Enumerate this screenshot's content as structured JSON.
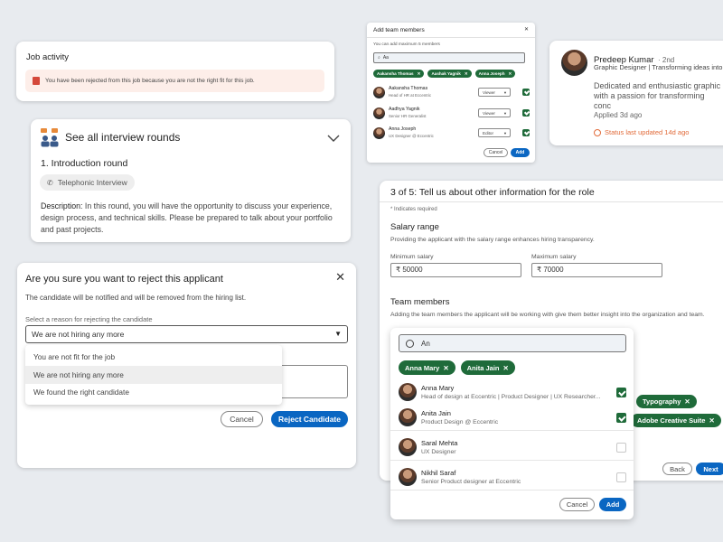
{
  "job_activity": {
    "title": "Job activity",
    "alert_text": "You have been rejected from this job because you are not the right fit for this job."
  },
  "interview": {
    "title": "See all interview rounds",
    "round_title": "1. Introduction round",
    "chip_label": "Telephonic Interview",
    "desc_label": "Description:",
    "desc_text": "In this round, you will have the opportunity to discuss your experience, design process, and technical skills. Please be prepared to talk about your portfolio and past projects."
  },
  "reject": {
    "title": "Are you sure you want to reject this applicant",
    "subtitle": "The candidate will be notified and will be removed from the hiring list.",
    "reason_label": "Select a reason for rejecting the candidate",
    "selected_value": "We are not hiring any more",
    "options": [
      "You are not fit for the job",
      "We are not hiring any more",
      "We found the right candidate"
    ],
    "cancel_label": "Cancel",
    "confirm_label": "Reject Candidate"
  },
  "add_team": {
    "title": "Add team members",
    "hint": "You can add maximum 5 members",
    "search_value": "Aa",
    "pills": [
      "Aakansha Thomas",
      "Aashak Yagnik",
      "Anna Joseph"
    ],
    "members": [
      {
        "name": "Aakansha Thomas",
        "role": "Head of HR at Eccentric",
        "permission": "Viewer",
        "checked": true
      },
      {
        "name": "Aadhya Yagnik",
        "role": "Senior HR Generalist",
        "permission": "Viewer",
        "checked": true
      },
      {
        "name": "Anna Joseph",
        "role": "UX Designer @ Eccentric",
        "permission": "Editor",
        "checked": true
      }
    ],
    "cancel_label": "Cancel",
    "add_label": "Add"
  },
  "profile": {
    "name": "Predeep Kumar",
    "degree": "· 2nd",
    "headline": "Graphic Designer | Transforming ideas into",
    "bio": "Dedicated and enthusiastic graphic with a passion for transforming conc",
    "applied": "Applied 3d ago",
    "status": "Status last updated 14d ago"
  },
  "role_form": {
    "title": "3 of 5: Tell us about other information for the role",
    "required_note": "* Indicates required",
    "salary_heading": "Salary range",
    "salary_desc": "Providing the applicant with the salary range enhances hiring transparency.",
    "min_label": "Minimum salary",
    "min_value": "50000",
    "max_label": "Maximum salary",
    "max_value": "70000",
    "currency": "₹",
    "team_heading": "Team members",
    "team_desc": "Adding the team members the applicant will be working with give them better insight into the organization and team.",
    "skill_pills": [
      "Typography",
      "Adobe Creative Suite"
    ],
    "back_label": "Back",
    "next_label": "Next"
  },
  "team_dropdown": {
    "search_value": "An",
    "pills": [
      "Anna Mary",
      "Anita Jain"
    ],
    "members": [
      {
        "name": "Anna Mary",
        "role": "Head of design at Eccentric | Product Designer | UX Researcher...",
        "checked": true
      },
      {
        "name": "Anita Jain",
        "role": "Product Design @ Eccentric",
        "checked": true
      },
      {
        "name": "Saral Mehta",
        "role": "UX Designer",
        "checked": false
      },
      {
        "name": "Nikhil Saraf",
        "role": "Senior Product designer at Eccentric",
        "checked": false
      }
    ],
    "cancel_label": "Cancel",
    "add_label": "Add"
  },
  "colors": {
    "background": "#e8ebef",
    "primary": "#0a66c2",
    "pill_green": "#1f6b3a",
    "alert_bg": "#fdeee9",
    "alert_icon": "#d4483a",
    "status_orange": "#e16b3a"
  }
}
